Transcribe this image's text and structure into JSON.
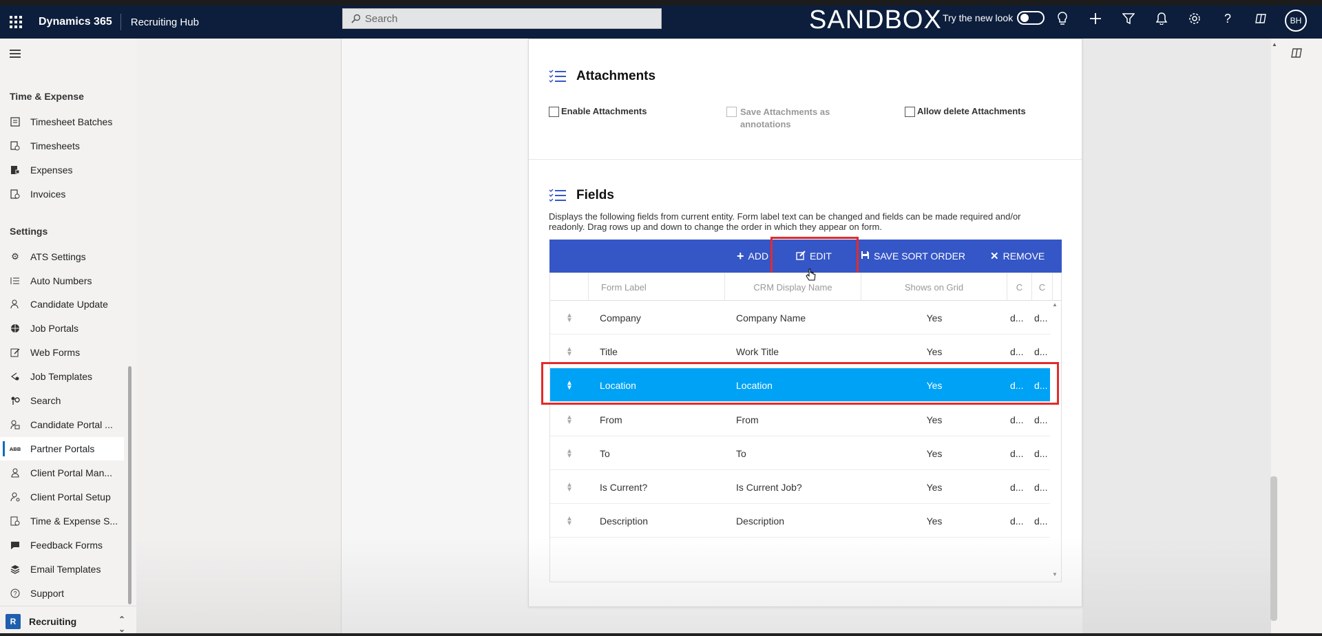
{
  "topbar": {
    "app_name": "Dynamics 365",
    "hub_name": "Recruiting Hub",
    "search_placeholder": "Search",
    "environment_label": "SANDBOX",
    "try_new_look": "Try the new look",
    "avatar_initials": "BH"
  },
  "sidebar": {
    "section_time": "Time & Expense",
    "time_items": [
      {
        "label": "Timesheet Batches",
        "icon": "batch-icon"
      },
      {
        "label": "Timesheets",
        "icon": "timesheet-icon"
      },
      {
        "label": "Expenses",
        "icon": "expense-icon"
      },
      {
        "label": "Invoices",
        "icon": "invoice-icon"
      }
    ],
    "section_settings": "Settings",
    "settings_items": [
      {
        "label": "ATS Settings",
        "icon": "gear-icon"
      },
      {
        "label": "Auto Numbers",
        "icon": "numbered-list-icon"
      },
      {
        "label": "Candidate Update",
        "icon": "person-update-icon"
      },
      {
        "label": "Job Portals",
        "icon": "globe-icon"
      },
      {
        "label": "Web Forms",
        "icon": "form-edit-icon"
      },
      {
        "label": "Job Templates",
        "icon": "template-icon"
      },
      {
        "label": "Search",
        "icon": "search-people-icon"
      },
      {
        "label": "Candidate Portal ...",
        "icon": "portal-icon"
      },
      {
        "label": "Partner Portals",
        "icon": "partners-icon"
      },
      {
        "label": "Client Portal Man...",
        "icon": "client-icon"
      },
      {
        "label": "Client Portal Setup",
        "icon": "client-setup-icon"
      },
      {
        "label": "Time & Expense S...",
        "icon": "time-settings-icon"
      },
      {
        "label": "Feedback Forms",
        "icon": "feedback-icon"
      },
      {
        "label": "Email Templates",
        "icon": "email-template-icon"
      },
      {
        "label": "Support",
        "icon": "help-icon"
      }
    ],
    "area_initial": "R",
    "area_name": "Recruiting"
  },
  "attachments": {
    "title": "Attachments",
    "enable_label": "Enable Attachments",
    "save_label_line1": "Save Attachments as",
    "save_label_line2": "annotations",
    "allow_delete_label": "Allow delete Attachments"
  },
  "fields": {
    "title": "Fields",
    "description": "Displays the following fields from current entity. Form label text can be changed and fields can be made required and/or readonly. Drag rows up and down to change the order in which they appear on form.",
    "toolbar": {
      "add": "ADD",
      "edit": "EDIT",
      "save_sort": "SAVE SORT ORDER",
      "remove": "REMOVE"
    },
    "columns": [
      "Form Label",
      "CRM Display Name",
      "Shows on Grid",
      "C",
      "C"
    ],
    "rows": [
      {
        "label": "Company",
        "crm": "Company Name",
        "grid": "Yes",
        "c1": "d...",
        "c2": "d..."
      },
      {
        "label": "Title",
        "crm": "Work Title",
        "grid": "Yes",
        "c1": "d...",
        "c2": "d..."
      },
      {
        "label": "Location",
        "crm": "Location",
        "grid": "Yes",
        "c1": "d...",
        "c2": "d..."
      },
      {
        "label": "From",
        "crm": "From",
        "grid": "Yes",
        "c1": "d...",
        "c2": "d..."
      },
      {
        "label": "To",
        "crm": "To",
        "grid": "Yes",
        "c1": "d...",
        "c2": "d..."
      },
      {
        "label": "Is Current?",
        "crm": "Is Current Job?",
        "grid": "Yes",
        "c1": "d...",
        "c2": "d..."
      },
      {
        "label": "Description",
        "crm": "Description",
        "grid": "Yes",
        "c1": "d...",
        "c2": "d..."
      }
    ],
    "selected_row": "Location"
  },
  "colors": {
    "topbar": "#0c1e3c",
    "toolbar": "#3556c6",
    "selected_row": "#00a2f5",
    "highlight": "#e52a2a"
  }
}
